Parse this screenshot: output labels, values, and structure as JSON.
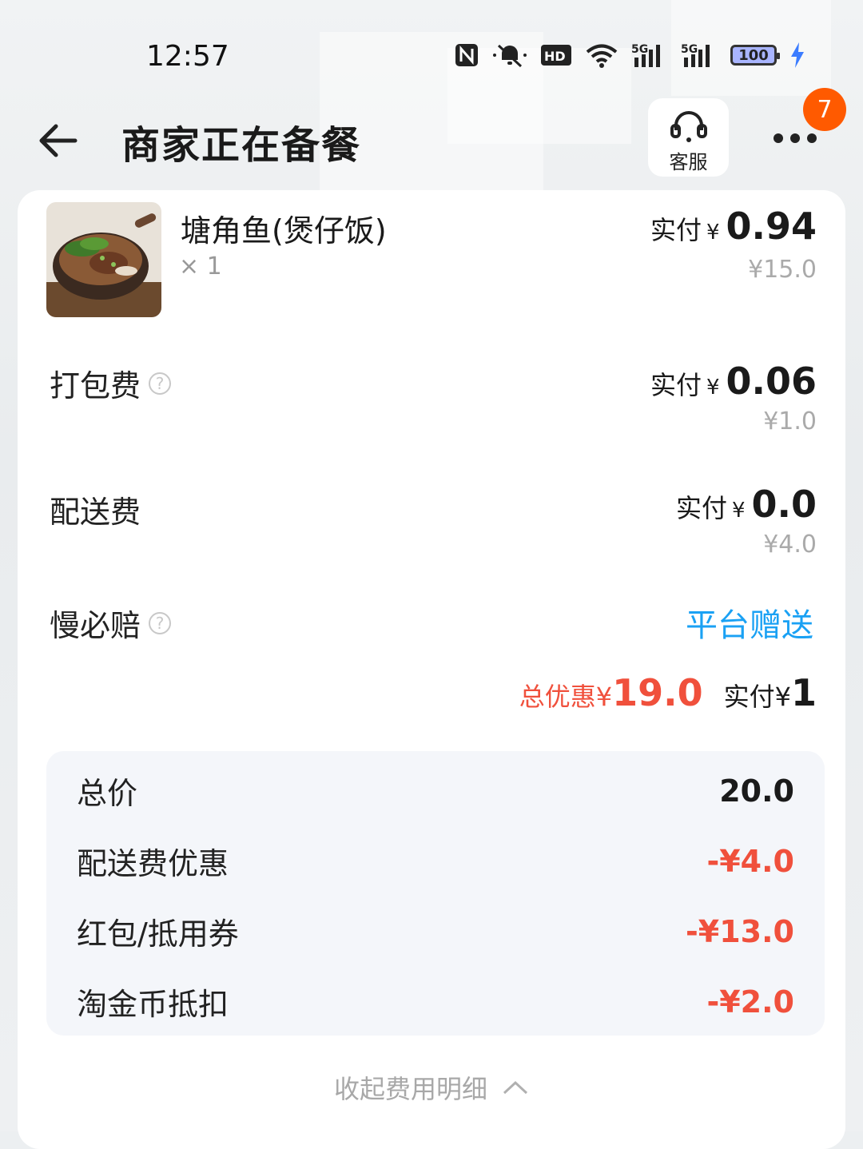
{
  "status_bar": {
    "time": "12:57",
    "net1": "5G",
    "net2": "5G",
    "hd": "HD",
    "battery": "100"
  },
  "header": {
    "title": "商家正在备餐",
    "service_label": "客服",
    "badge_count": "7"
  },
  "item": {
    "name": "塘角鱼(煲仔饭)",
    "qty": "× 1",
    "paid_label": "实付",
    "currency": "¥",
    "paid_value": "0.94",
    "original": "¥15.0"
  },
  "fees": [
    {
      "label": "打包费",
      "paid_label": "实付",
      "currency": "¥",
      "paid_value": "0.06",
      "original": "¥1.0"
    },
    {
      "label": "配送费",
      "paid_label": "实付",
      "currency": "¥",
      "paid_value": "0.0",
      "original": "¥4.0"
    }
  ],
  "slow_comp": {
    "label": "慢必赔",
    "value": "平台赠送"
  },
  "summary": {
    "discount_label": "总优惠¥",
    "discount_value": "19.0",
    "total_label": "实付¥",
    "total_value": "1"
  },
  "detail": [
    {
      "label": "总价",
      "value": "20.0"
    },
    {
      "label": "配送费优惠",
      "value": "-¥4.0"
    },
    {
      "label": "红包/抵用券",
      "value": "-¥13.0"
    },
    {
      "label": "淘金币抵扣",
      "value": "-¥2.0"
    }
  ],
  "collapse_label": "收起费用明细",
  "colors": {
    "discount": "#f0503c",
    "gift": "#1aa1f4",
    "badge": "#ff5a00"
  }
}
